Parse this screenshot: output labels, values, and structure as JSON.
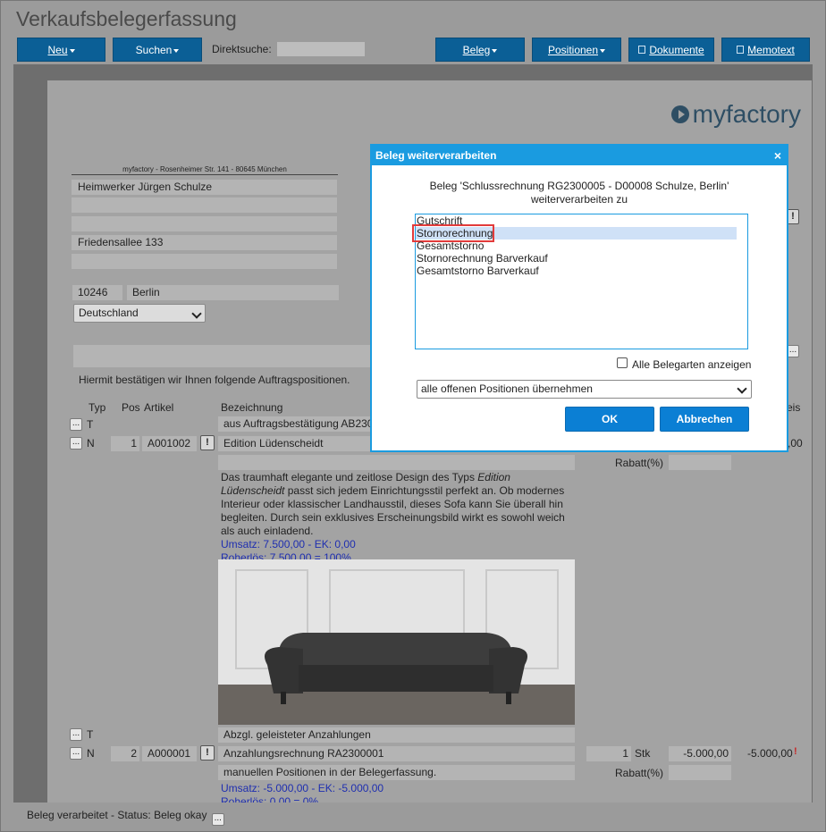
{
  "window": {
    "title": "Verkaufsbelegerfassung"
  },
  "toolbar": {
    "neu": "Neu",
    "suchen": "Suchen",
    "direktsuche_label": "Direktsuche:",
    "direktsuche_value": "",
    "beleg": "Beleg",
    "positionen": "Positionen",
    "dokumente": "Dokumente",
    "memotext": "Memotext"
  },
  "document": {
    "logo": "myfactory",
    "sender_line": "myfactory - Rosenheimer Str. 141 - 80645 München",
    "address": {
      "name": "Heimwerker Jürgen Schulze",
      "line2": "",
      "line3": "",
      "street": "Friedensallee 133",
      "line5": "",
      "zip": "10246",
      "city": "Berlin",
      "country": "Deutschland"
    },
    "confirmation_text": "Hiermit bestätigen wir Ihnen folgende Auftragspositionen.",
    "columns": {
      "typ": "Typ",
      "pos": "Pos",
      "artikel": "Artikel",
      "bezeichnung": "Bezeichnung",
      "preis_partial": "eis"
    },
    "rows": {
      "r1": {
        "btn": "...",
        "typ": "T",
        "bezeichnung": "aus Auftragsbestätigung AB230"
      },
      "r2": {
        "btn": "...",
        "typ": "N",
        "pos": "1",
        "artikel": "A001002",
        "excl": "!",
        "bezeichnung": "Edition Lüdenscheidt",
        "rabatt_label": "Rabatt(%)",
        "preis_partial": ",00"
      },
      "r3": {
        "btn": "...",
        "typ": "T",
        "bezeichnung": "Abzgl. geleisteter Anzahlungen"
      },
      "r4": {
        "btn": "...",
        "typ": "N",
        "pos": "2",
        "artikel": "A000001",
        "excl": "!",
        "bezeichnung": "Anzahlungsrechnung RA2300001",
        "menge": "1",
        "einheit": "Stk",
        "einzelpreis": "-5.000,00",
        "gesamtpreis": "-5.000,00",
        "rabatt_label": "Rabatt(%)",
        "bezeichnung2": "manuellen Positionen in der Belegerfassung."
      }
    },
    "description": {
      "part1": "Das traumhaft elegante und zeitlose Design des Typs ",
      "italic1": "Edition",
      "italic2": "Lüdenscheidt",
      "part2": " passt sich jedem Einrichtungsstil perfekt an. Ob modernes Interieur oder klassischer Landhausstil, dieses Sofa kann Sie überall hin begleiten. Durch sein exklusives Erscheinungsbild wirkt es sowohl weich als auch einladend.",
      "umsatz1": "Umsatz: 7.500,00 - EK: 0,00",
      "roherloes1": "Roherlös: 7.500,00 = 100%",
      "umsatz2": "Umsatz: -5.000,00 - EK: -5.000,00",
      "roherloes2": "Roherlös: 0,00 = 0%"
    },
    "right_edge": {
      "excl": "!",
      "dots": "..."
    }
  },
  "status": {
    "text": "Beleg verarbeitet - Status: Beleg okay",
    "btn": "..."
  },
  "dialog": {
    "title": "Beleg weiterverarbeiten",
    "close": "×",
    "message_line1": "Beleg 'Schlussrechnung RG2300005 - D00008 Schulze, Berlin'",
    "message_line2": "weiterverarbeiten zu",
    "options": [
      "Gutschrift",
      "Stornorechnung",
      "Gesamtstorno",
      "Stornorechnung Barverkauf",
      "Gesamtstorno Barverkauf"
    ],
    "selected_option": "Stornorechnung",
    "checkbox_label": "Alle Belegarten anzeigen",
    "checkbox_checked": false,
    "positions_select": "alle offenen Positionen übernehmen",
    "ok": "OK",
    "cancel": "Abbrechen"
  },
  "colors": {
    "toolbar_button": "#0b5f96",
    "dialog_accent": "#1a9be0",
    "dialog_button": "#0b7fd4",
    "highlight": "#e23b3b"
  }
}
